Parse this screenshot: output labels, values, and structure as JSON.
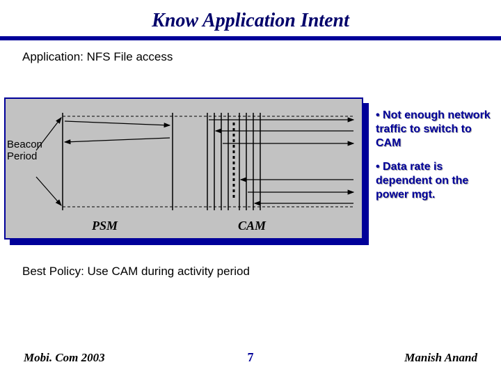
{
  "title": "Know Application Intent",
  "subtitle": "Application: NFS File access",
  "diagram": {
    "beacon_label": "Beacon Period",
    "psm_label": "PSM",
    "cam_label": "CAM"
  },
  "bullets": {
    "b1": "Not enough network traffic to switch to CAM",
    "b2": "Data rate is dependent on the power mgt."
  },
  "policy": "Best Policy: Use CAM during activity period",
  "footer": {
    "left": "Mobi. Com 2003",
    "center": "7",
    "right": "Manish Anand"
  }
}
